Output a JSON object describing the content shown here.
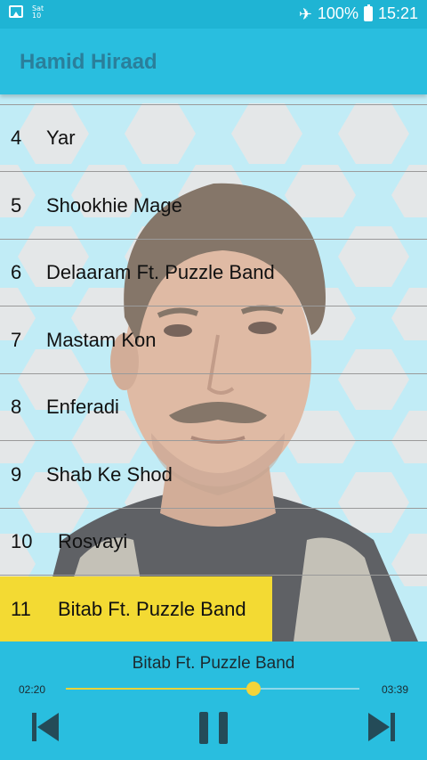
{
  "status_bar": {
    "calendar_day": "Sat",
    "calendar_date": "10",
    "battery": "100%",
    "time": "15:21",
    "icons": [
      "gallery-icon",
      "calendar-icon",
      "airplane-mode-icon",
      "battery-icon"
    ]
  },
  "app_bar": {
    "title": "Hamid Hiraad"
  },
  "tracks": [
    {
      "number": "4",
      "title": "Yar"
    },
    {
      "number": "5",
      "title": "Shookhie Mage"
    },
    {
      "number": "6",
      "title": "Delaaram Ft. Puzzle Band"
    },
    {
      "number": "7",
      "title": "Mastam Kon"
    },
    {
      "number": "8",
      "title": "Enferadi"
    },
    {
      "number": "9",
      "title": "Shab Ke Shod"
    },
    {
      "number": "10",
      "title": "Rosvayi"
    },
    {
      "number": "11",
      "title": "Bitab Ft. Puzzle Band"
    }
  ],
  "player": {
    "now_playing": "Bitab Ft. Puzzle Band",
    "current_time": "02:20",
    "total_time": "03:39",
    "progress": 0.64,
    "controls": [
      "previous-icon",
      "pause-icon",
      "next-icon"
    ]
  },
  "colors": {
    "primary": "#29bedf",
    "title": "#2a7f9b",
    "active_row": "#f3da33",
    "seek_thumb": "#f2d43a"
  }
}
